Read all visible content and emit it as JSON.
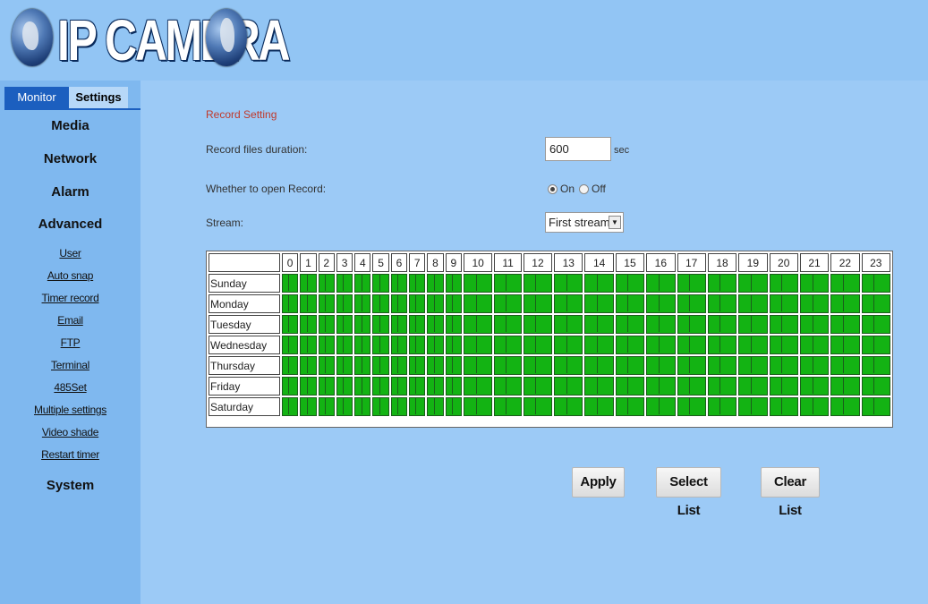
{
  "header": {
    "logo_text": "IP CAMERA"
  },
  "sidebar": {
    "tabs": [
      {
        "label": "Monitor"
      },
      {
        "label": "Settings"
      }
    ],
    "main_items": [
      {
        "label": "Media"
      },
      {
        "label": "Network"
      },
      {
        "label": "Alarm"
      },
      {
        "label": "Advanced"
      },
      {
        "label": "System"
      }
    ],
    "sub_items": [
      {
        "label": "User"
      },
      {
        "label": "Auto snap"
      },
      {
        "label": "Timer record"
      },
      {
        "label": "Email"
      },
      {
        "label": "FTP"
      },
      {
        "label": "Terminal"
      },
      {
        "label": "485Set"
      },
      {
        "label": "Multiple settings"
      },
      {
        "label": "Video shade"
      },
      {
        "label": "Restart timer"
      }
    ]
  },
  "main": {
    "section_title": "Record Setting",
    "duration_label": "Record files duration:",
    "duration_value": "600",
    "duration_unit": "sec",
    "open_record_label": "Whether to open Record:",
    "open_record_on": "On",
    "open_record_off": "Off",
    "open_record_selected": "On",
    "stream_label": "Stream:",
    "stream_value": "First stream",
    "schedule": {
      "hours": [
        "0",
        "1",
        "2",
        "3",
        "4",
        "5",
        "6",
        "7",
        "8",
        "9",
        "10",
        "11",
        "12",
        "13",
        "14",
        "15",
        "16",
        "17",
        "18",
        "19",
        "20",
        "21",
        "22",
        "23"
      ],
      "days": [
        "Sunday",
        "Monday",
        "Tuesday",
        "Wednesday",
        "Thursday",
        "Friday",
        "Saturday"
      ],
      "cell_color": "#13b313"
    },
    "buttons": {
      "apply": "Apply",
      "select_list": "Select List",
      "clear_list": "Clear List"
    }
  },
  "colors": {
    "header_bg": "#92c5f4",
    "sidebar_bg": "#7fb8ef",
    "main_bg": "#9ccaf6",
    "tab_active": "#1c5fbf",
    "title_red": "#c0392b"
  }
}
